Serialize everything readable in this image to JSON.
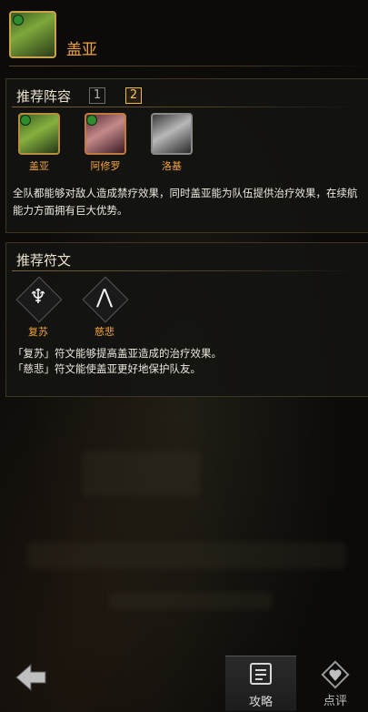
{
  "header": {
    "hero_name": "盖亚"
  },
  "lineup": {
    "title": "推荐阵容",
    "tabs": [
      "1",
      "2"
    ],
    "active_tab": "2",
    "heroes": [
      {
        "name": "盖亚"
      },
      {
        "name": "阿修罗"
      },
      {
        "name": "洛基"
      }
    ],
    "description": "全队都能够对敌人造成禁疗效果，同时盖亚能为队伍提供治疗效果，在续航能力方面拥有巨大优势。"
  },
  "runes": {
    "title": "推荐符文",
    "items": [
      {
        "name": "复苏",
        "icon": "wings-icon"
      },
      {
        "name": "慈悲",
        "icon": "praying-hands-icon"
      }
    ],
    "description_lines": [
      "「复苏」符文能够提高盖亚造成的治疗效果。",
      "「慈悲」符文能使盖亚更好地保护队友。"
    ]
  },
  "bottom_nav": {
    "guide_label": "攻略",
    "review_label": "点评"
  }
}
